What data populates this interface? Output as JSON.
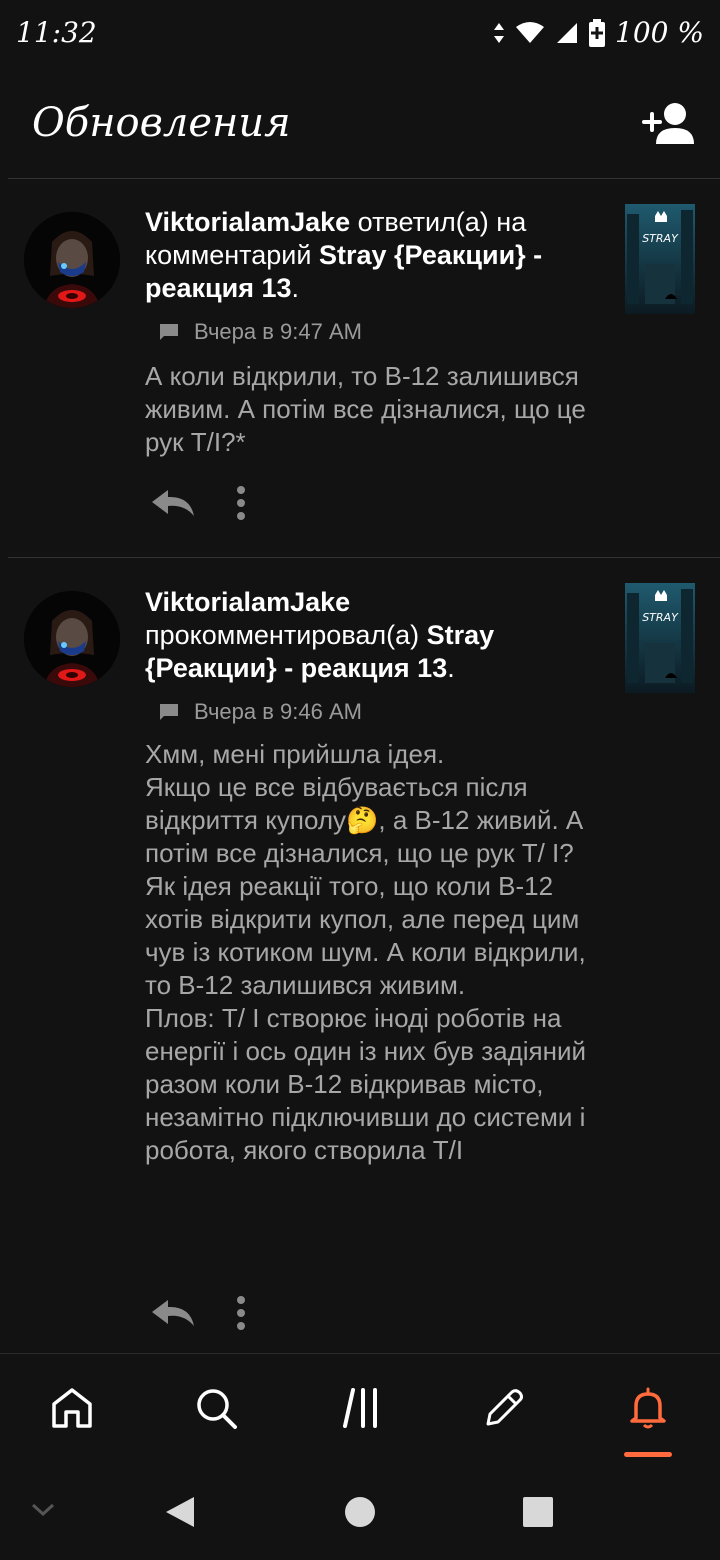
{
  "status": {
    "time": "11:32",
    "battery": "100 %"
  },
  "header": {
    "title": "Обновления"
  },
  "notifications": [
    {
      "username": "ViktorialamJake",
      "action_text": " ответил(а) на комментарий ",
      "story": "Stray {Реакции} - реакция 13",
      "end": ".",
      "time": "Вчера в 9:47 AM",
      "body": "А коли відкрили, то В-12 залишився живим. А потім все дізналися, що це рук Т/І?*"
    },
    {
      "username": "ViktorialamJake",
      "action_text": " прокомментировал(а) ",
      "story": "Stray {Реакции} - реакция 13",
      "end": ".",
      "time": "Вчера в 9:46 AM",
      "body": "Хмм, мені прийшла ідея.\nЯкщо це все відбувається після відкриття куполу🤔, а В-12 живий. А потім все дізналися, що це рук Т/ І?\nЯк ідея реакції того, що коли В-12 хотів відкрити купол, але перед цим чув із котиком шум. А коли відкрили, то В-12 залишився живим.\nПлов: Т/ І створює іноді роботів на енергії і ось один із них був задіяний разом коли В-12 відкривав місто, незамітно підключивши до системи і робота, якого створила Т/І"
    }
  ],
  "bottom_nav": {
    "items": [
      "home-icon",
      "search-icon",
      "library-icon",
      "write-icon",
      "bell-icon"
    ],
    "active": "bell-icon",
    "active_color": "#ff6b3d"
  },
  "icons": {
    "thumb_text": "STRAY"
  }
}
